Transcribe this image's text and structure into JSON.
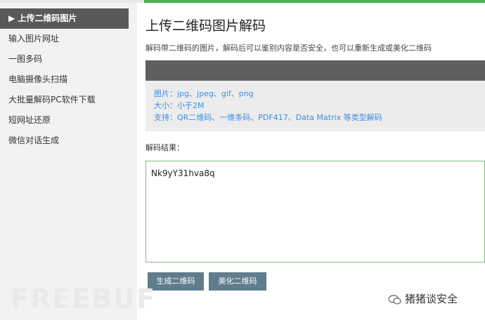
{
  "sidebar": {
    "items": [
      {
        "label": "▶ 上传二维码图片",
        "active": true
      },
      {
        "label": "输入图片网址"
      },
      {
        "label": "一图多码"
      },
      {
        "label": "电脑摄像头扫描"
      },
      {
        "label": "大批量解码PC软件下载"
      },
      {
        "label": "短网址还原"
      },
      {
        "label": "微信对话生成"
      }
    ]
  },
  "main": {
    "title": "上传二维码图片解码",
    "description": "解码带二维码的图片，解码后可以鉴别内容是否安全，也可以重新生成或美化二维码",
    "info": {
      "formats": "图片：jpg、jpeg、gif、png",
      "size": "大小：小于2M",
      "support": "支持：QR二维码、一维条码、PDF417、Data Matrix 等类型解码"
    },
    "result_label": "解码结果：",
    "result_value": "Nk9yY31hva8q",
    "buttons": {
      "generate": "生成二维码",
      "beautify": "美化二维码"
    }
  },
  "watermark": {
    "left": "FREEBUF",
    "right": "猪猪谈安全"
  },
  "colors": {
    "accent": "#4caf50",
    "button": "#607d8b",
    "link": "#3a8ee6",
    "sidebar_active": "#595959"
  }
}
